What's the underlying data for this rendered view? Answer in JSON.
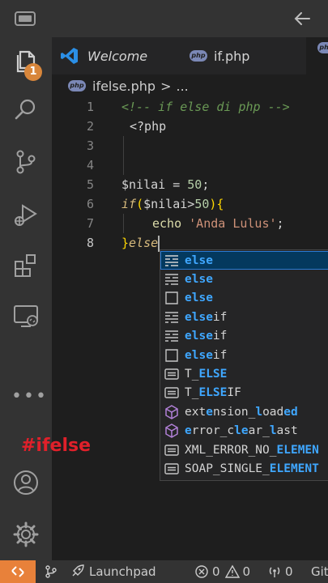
{
  "tabs": [
    {
      "label": "Welcome",
      "icon": "vscode-logo-icon"
    },
    {
      "label": "if.php",
      "icon": "php-file-icon"
    }
  ],
  "file_icon_text": "php",
  "breadcrumb": {
    "file": "ifelse.php",
    "separator": ">",
    "more": "..."
  },
  "activity": {
    "explorer_badge": "1"
  },
  "editor": {
    "line_numbers": [
      "1",
      "2",
      "3",
      "4",
      "5",
      "6",
      "7",
      "8"
    ],
    "lines": {
      "l1": "<!-- if else di php -->",
      "l2": "<?php",
      "l5_var": "$nilai",
      "l5_eq": " = ",
      "l5_num": "50",
      "l5_end": ";",
      "l6_kw": "if",
      "l6_open": "(",
      "l6_var": "$nilai",
      "l6_op": ">",
      "l6_num": "50",
      "l6_close": ")",
      "l6_brace": "{",
      "l7_fn": "echo",
      "l7_str": "'Anda Lulus'",
      "l7_end": ";",
      "l8_brace": "}",
      "l8_kw": "else"
    }
  },
  "watermark": "#ifelse",
  "suggestions": [
    {
      "pre": "",
      "hl": "else",
      "post": "",
      "icon": "snippet-icon"
    },
    {
      "pre": "",
      "hl": "else",
      "post": "",
      "icon": "snippet-icon"
    },
    {
      "pre": "",
      "hl": "else",
      "post": "",
      "icon": "keyword-box-icon"
    },
    {
      "pre": "",
      "hl": "else",
      "post": "if",
      "icon": "snippet-icon"
    },
    {
      "pre": "",
      "hl": "else",
      "post": "if",
      "icon": "snippet-icon"
    },
    {
      "pre": "",
      "hl": "else",
      "post": "if",
      "icon": "keyword-box-icon"
    },
    {
      "pre": "T_",
      "hl": "ELSE",
      "post": "",
      "icon": "constant-icon"
    },
    {
      "pre": "T_",
      "hl": "ELSE",
      "post": "IF",
      "icon": "constant-icon"
    },
    {
      "segs": [
        [
          "",
          ""
        ],
        [
          "e",
          ""
        ],
        [
          "xt",
          ""
        ],
        [
          "e",
          "hl"
        ],
        [
          "nsion_",
          ""
        ],
        [
          "l",
          "hl"
        ],
        [
          "oa",
          ""
        ],
        [
          "d",
          ""
        ],
        [
          "ed",
          "hl"
        ]
      ],
      "plain": "extension_loaded",
      "icon": "method-cube-icon"
    },
    {
      "plain": "error_clear_last",
      "icon": "method-cube-icon"
    },
    {
      "pre": "XML_ERROR_NO_",
      "hl": "ELEMEN",
      "post": "",
      "icon": "constant-icon"
    },
    {
      "pre": "SOAP_SINGLE_",
      "hl": "ELEMENT",
      "post": "",
      "icon": "constant-icon"
    }
  ],
  "statusbar": {
    "launchpad": "Launchpad",
    "errors": "0",
    "warnings": "0",
    "ports": "0",
    "git": "Git"
  },
  "colors": {
    "accent_orange": "#e8813a",
    "selection_blue": "#04395e",
    "match_highlight": "#3fa7ff",
    "watermark_red": "#e0202a"
  }
}
